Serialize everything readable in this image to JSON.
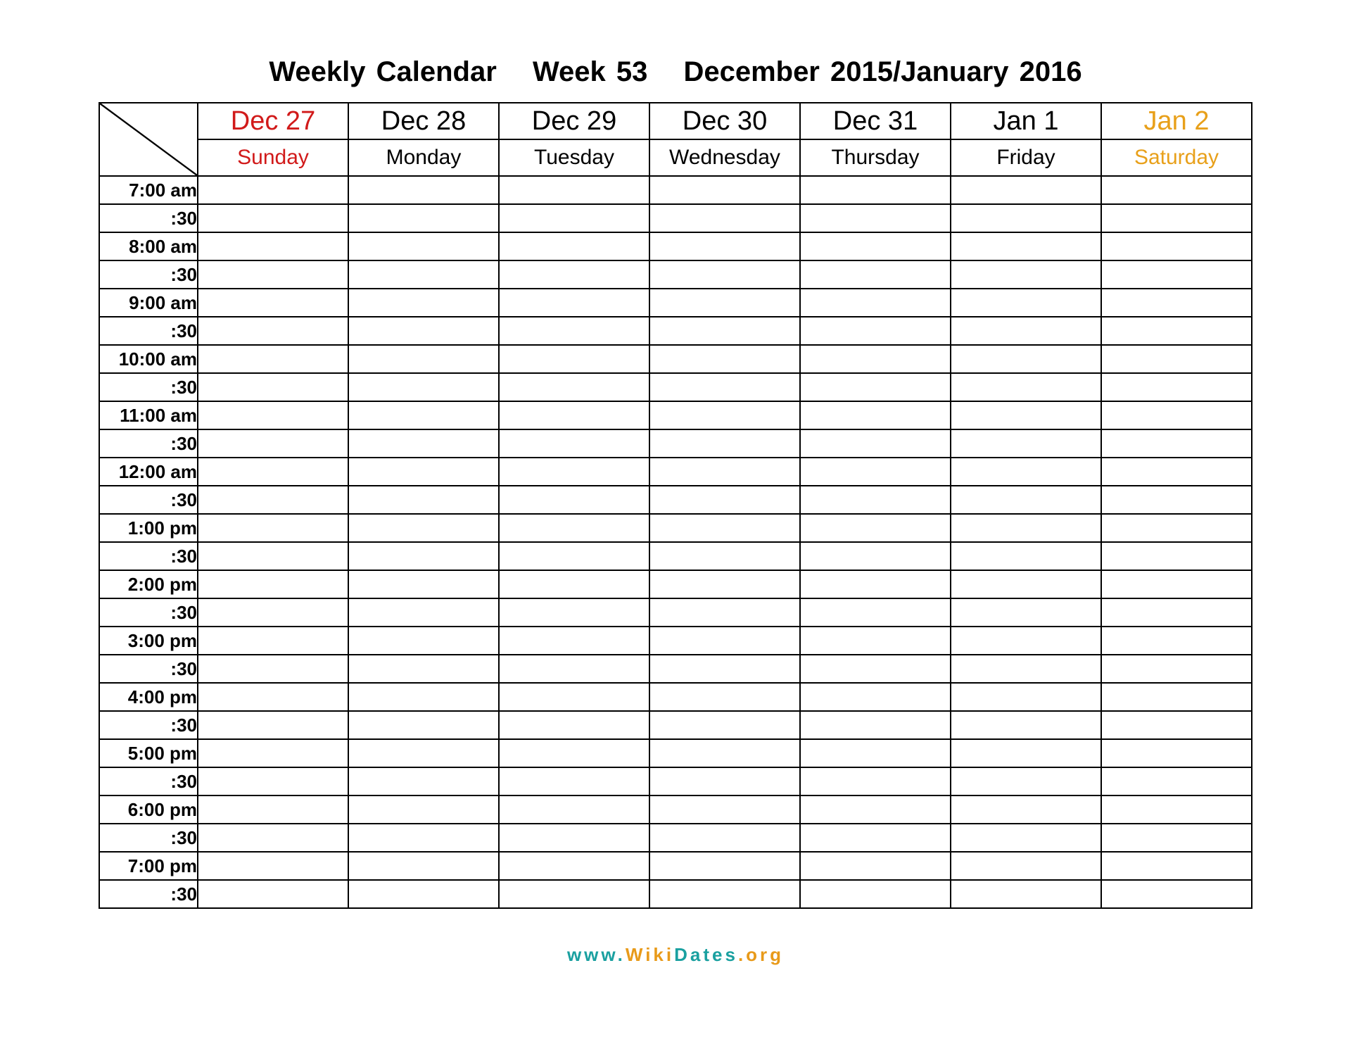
{
  "title": {
    "label": "Weekly Calendar",
    "week": "Week 53",
    "range": "December 2015/January 2016"
  },
  "days": [
    {
      "date": "Dec 27",
      "name": "Sunday",
      "cls": "sun"
    },
    {
      "date": "Dec 28",
      "name": "Monday",
      "cls": ""
    },
    {
      "date": "Dec 29",
      "name": "Tuesday",
      "cls": ""
    },
    {
      "date": "Dec 30",
      "name": "Wednesday",
      "cls": ""
    },
    {
      "date": "Dec 31",
      "name": "Thursday",
      "cls": ""
    },
    {
      "date": "Jan 1",
      "name": "Friday",
      "cls": ""
    },
    {
      "date": "Jan 2",
      "name": "Saturday",
      "cls": "sat"
    }
  ],
  "times": [
    "7:00 am",
    ":30",
    "8:00 am",
    ":30",
    "9:00 am",
    ":30",
    "10:00 am",
    ":30",
    "11:00 am",
    ":30",
    "12:00 am",
    ":30",
    "1:00 pm",
    ":30",
    "2:00 pm",
    ":30",
    "3:00 pm",
    ":30",
    "4:00 pm",
    ":30",
    "5:00 pm",
    ":30",
    "6:00 pm",
    ":30",
    "7:00 pm",
    ":30"
  ],
  "footer": {
    "www": "www.",
    "wiki": "Wiki",
    "dates": "Dates",
    "org": ".org"
  }
}
